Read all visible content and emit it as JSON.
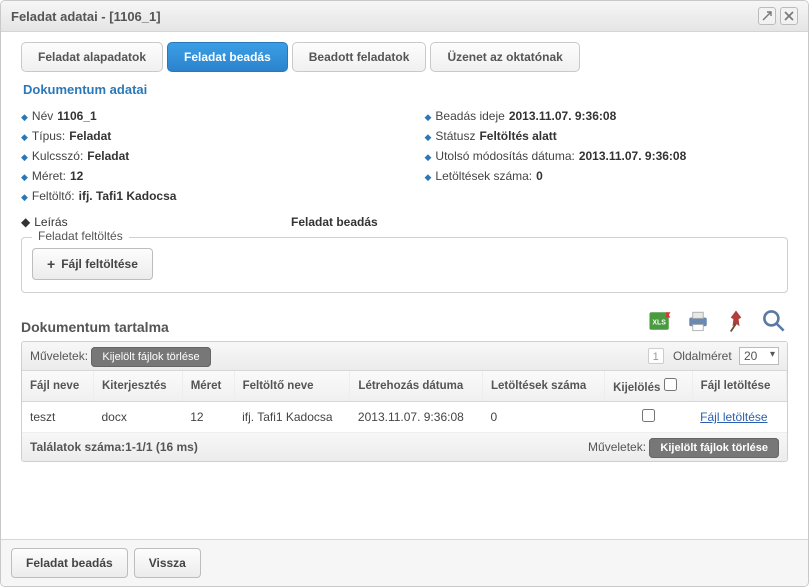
{
  "window": {
    "title": "Feladat adatai - [1106_1]"
  },
  "tabs": [
    {
      "label": "Feladat alapadatok",
      "active": false
    },
    {
      "label": "Feladat beadás",
      "active": true
    },
    {
      "label": "Beadott feladatok",
      "active": false
    },
    {
      "label": "Üzenet az oktatónak",
      "active": false
    }
  ],
  "section_heading": "Dokumentum adatai",
  "details_left": {
    "name_label": "Név",
    "name_value": "1106_1",
    "type_label": "Típus:",
    "type_value": "Feladat",
    "keyword_label": "Kulcsszó:",
    "keyword_value": "Feladat",
    "size_label": "Méret:",
    "size_value": "12",
    "uploader_label": "Feltöltő:",
    "uploader_value": "ifj. Tafi1 Kadocsa",
    "desc_label": "Leírás"
  },
  "details_right": {
    "submit_time_label": "Beadás ideje",
    "submit_time_value": "2013.11.07. 9:36:08",
    "status_label": "Státusz",
    "status_value": "Feltöltés alatt",
    "lastmod_label": "Utolsó módosítás dátuma:",
    "lastmod_value": "2013.11.07. 9:36:08",
    "downloads_label": "Letöltések száma:",
    "downloads_value": "0"
  },
  "desc_value": "Feladat beadás",
  "upload_fieldset": {
    "legend": "Feladat feltöltés",
    "button": "Fájl feltöltése"
  },
  "doc_content_title": "Dokumentum tartalma",
  "grid": {
    "ops_label": "Műveletek:",
    "delete_selected": "Kijelölt fájlok törlése",
    "page_number": "1",
    "pagesize_label": "Oldalméret",
    "pagesize_value": "20",
    "columns": {
      "filename": "Fájl neve",
      "ext": "Kiterjesztés",
      "size": "Méret",
      "uploader": "Feltöltő neve",
      "created": "Létrehozás dátuma",
      "downloads": "Letöltések száma",
      "select": "Kijelölés",
      "download": "Fájl letöltése"
    },
    "rows": [
      {
        "filename": "teszt",
        "ext": "docx",
        "size": "12",
        "uploader": "ifj. Tafi1 Kadocsa",
        "created": "2013.11.07. 9:36:08",
        "downloads": "0",
        "download_link": "Fájl letöltése"
      }
    ],
    "results_text": "Találatok száma:1-1/1 (16 ms)"
  },
  "footer": {
    "submit": "Feladat beadás",
    "back": "Vissza"
  }
}
